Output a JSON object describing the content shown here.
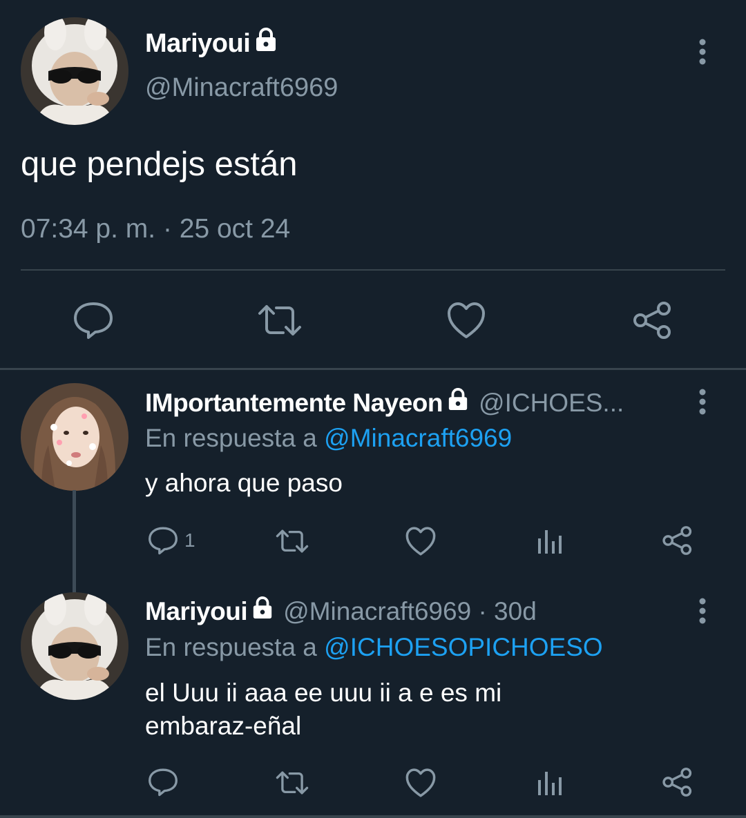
{
  "main_tweet": {
    "author_name": "Mariyoui",
    "author_handle": "@Minacraft6969",
    "text": "que pendejs están",
    "timestamp": "07:34 p. m. · 25 oct 24",
    "actions": [
      "reply-icon",
      "retweet-icon",
      "like-icon",
      "share-icon"
    ]
  },
  "replies": [
    {
      "author_name": "IMportantemente Nayeon",
      "author_handle": "@ICHOES...",
      "reply_prefix": "En respuesta a ",
      "reply_mention": "@Minacraft6969",
      "text": "y ahora que paso",
      "reply_count": "1",
      "actions": [
        "reply-icon",
        "retweet-icon",
        "like-icon",
        "analytics-icon",
        "share-icon"
      ]
    },
    {
      "author_name": "Mariyoui",
      "author_handle": "@Minacraft6969 · 30d",
      "reply_prefix": "En respuesta a ",
      "reply_mention": "@ICHOESOPICHOESO",
      "text": "el Uuu ii aaa ee uuu ii a e es mi embaraz-eñal",
      "reply_count": "",
      "actions": [
        "reply-icon",
        "retweet-icon",
        "like-icon",
        "analytics-icon",
        "share-icon"
      ]
    }
  ],
  "colors": {
    "background": "#15202b",
    "secondary_text": "#8899a6",
    "link": "#1da1f2",
    "divider": "#38444d"
  }
}
